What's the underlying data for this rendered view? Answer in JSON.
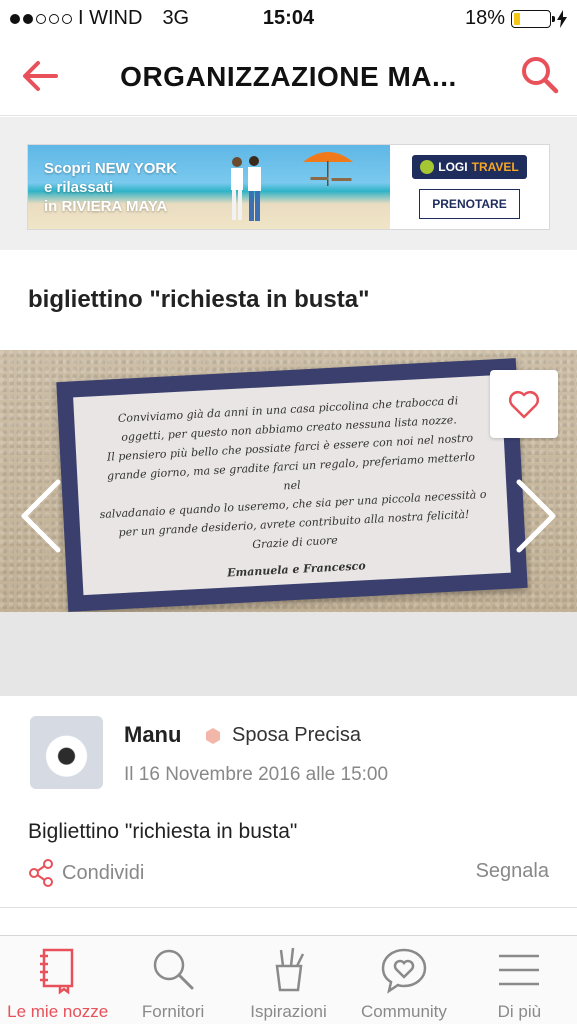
{
  "status_bar": {
    "carrier": "I WIND",
    "network": "3G",
    "time": "15:04",
    "battery_percent": "18%",
    "battery_level": 0.18,
    "signal_bars_filled": 2,
    "signal_bars_total": 5
  },
  "nav": {
    "title": "ORGANIZZAZIONE MA...",
    "back_icon": "arrow-left-icon",
    "search_icon": "search-icon",
    "accent_color": "#e8515a"
  },
  "ad": {
    "line1": "Scopri NEW YORK",
    "line2": "e rilassati",
    "line3": "in RIVIERA MAYA",
    "brand_logi": "LOGI",
    "brand_travel": "TRAVEL",
    "cta": "PRENOTARE"
  },
  "post": {
    "title": "bigliettino \"richiesta in busta\"",
    "card_text": [
      "Conviviamo già da anni in una casa piccolina che trabocca di",
      "oggetti, per questo non abbiamo creato nessuna lista nozze.",
      "Il pensiero più bello che possiate farci è essere con noi nel nostro",
      "grande giorno, ma se gradite farci un regalo, preferiamo metterlo nel",
      "salvadanaio e quando lo useremo, che sia per una piccola necessità o",
      "per un grande desiderio, avrete contribuito alla nostra felicità!",
      "Grazie di cuore"
    ],
    "card_signature": "Emanuela e Francesco",
    "body": "Bigliettino \"richiesta in busta\""
  },
  "author": {
    "name": "Manu",
    "role": "Sposa Precisa",
    "date": "Il 16 Novembre 2016 alle 15:00",
    "badge_color": "#f2b7a8"
  },
  "actions": {
    "share": "Condividi",
    "report": "Segnala"
  },
  "tabs": [
    {
      "label": "Le mie nozze",
      "icon": "notebook-icon",
      "active": true
    },
    {
      "label": "Fornitori",
      "icon": "search-icon",
      "active": false
    },
    {
      "label": "Ispirazioni",
      "icon": "pencil-cup-icon",
      "active": false
    },
    {
      "label": "Community",
      "icon": "chat-heart-icon",
      "active": false
    },
    {
      "label": "Di più",
      "icon": "menu-icon",
      "active": false
    }
  ]
}
